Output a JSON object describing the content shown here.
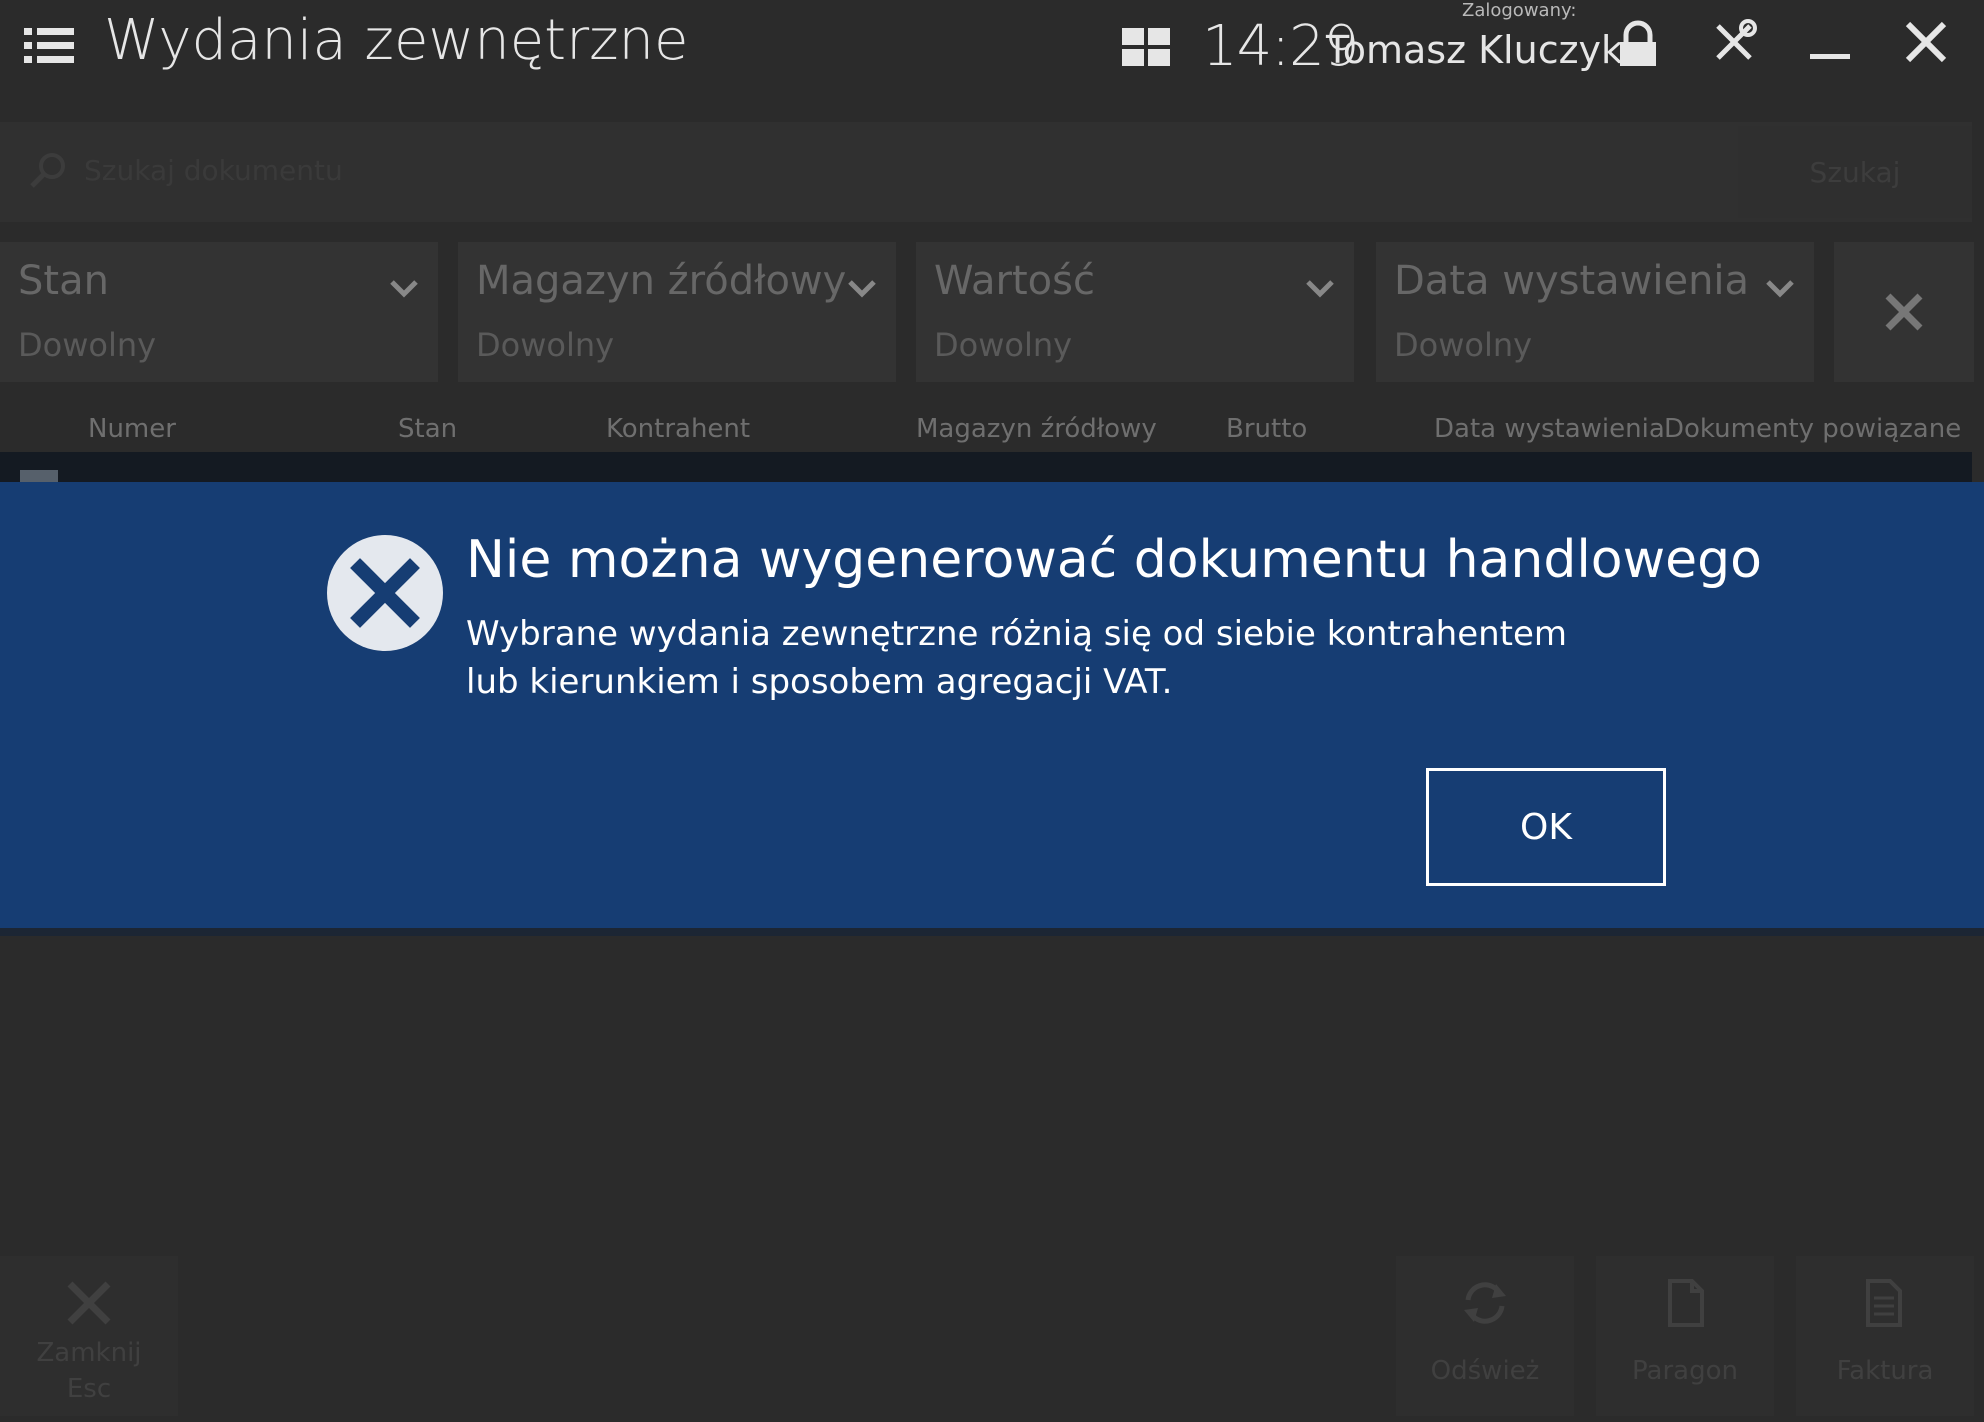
{
  "header": {
    "title": "Wydania zewnętrzne",
    "time": "14:29",
    "logged_in_label": "Zalogowany:",
    "user_name": "Tomasz Kluczyk"
  },
  "search": {
    "placeholder": "Szukaj dokumentu",
    "button_label": "Szukaj"
  },
  "filters": [
    {
      "label": "Stan",
      "value": "Dowolny"
    },
    {
      "label": "Magazyn źródłowy",
      "value": "Dowolny"
    },
    {
      "label": "Wartość",
      "value": "Dowolny"
    },
    {
      "label": "Data wystawienia",
      "value": "Dowolny"
    }
  ],
  "columns": [
    "Numer",
    "Stan",
    "Kontrahent",
    "Magazyn źródłowy",
    "Brutto",
    "Data wystawienia",
    "Dokumenty powiązane"
  ],
  "dialog": {
    "title": "Nie można wygenerować dokumentu handlowego",
    "message": "Wybrane wydania zewnętrzne różnią się od siebie kontrahentem lub kierunkiem i sposobem agregacji VAT.",
    "ok_label": "OK"
  },
  "bottom_bar": {
    "close_label": "Zamknij",
    "close_shortcut": "Esc",
    "refresh_label": "Odśwież",
    "receipt_label": "Paragon",
    "invoice_label": "Faktura"
  },
  "colors": {
    "background": "#2b2b2b",
    "dialog_background": "#163d73",
    "dialog_text": "#ffffff"
  }
}
